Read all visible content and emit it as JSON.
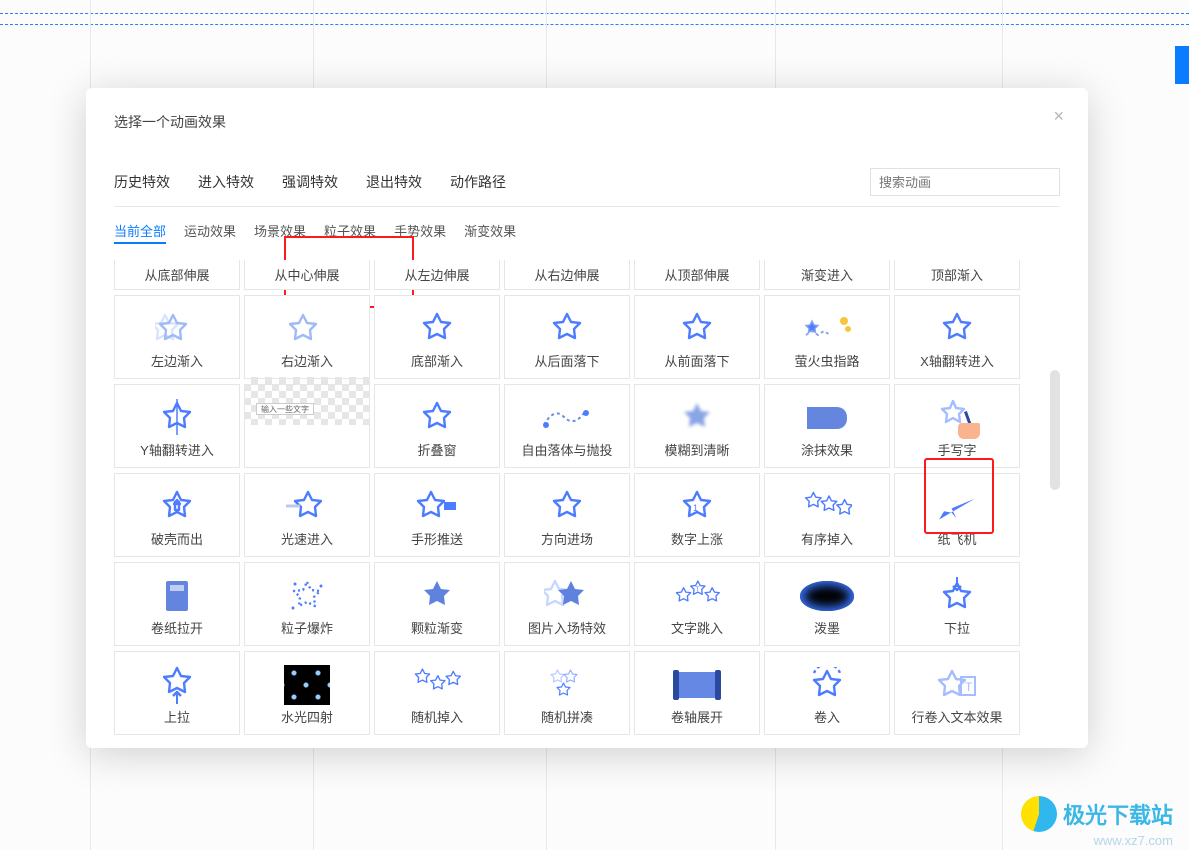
{
  "modal_title": "选择一个动画效果",
  "search_placeholder": "搜索动画",
  "tabs_main": [
    "历史特效",
    "进入特效",
    "强调特效",
    "退出特效",
    "动作路径"
  ],
  "tabs_sub": [
    "当前全部",
    "运动效果",
    "场景效果",
    "粒子效果",
    "手势效果",
    "渐变效果"
  ],
  "tab_main_selected": 1,
  "tab_sub_selected": 0,
  "checker_label": "输入一些文字",
  "effects": [
    [
      "从底部伸展",
      "从中心伸展",
      "从左边伸展",
      "从右边伸展",
      "从顶部伸展",
      "渐变进入",
      "顶部渐入"
    ],
    [
      "左边渐入",
      "右边渐入",
      "底部渐入",
      "从后面落下",
      "从前面落下",
      "萤火虫指路",
      "X轴翻转进入"
    ],
    [
      "Y轴翻转进入",
      "",
      "折叠窗",
      "自由落体与抛投",
      "模糊到清晰",
      "涂抹效果",
      "手写字"
    ],
    [
      "破壳而出",
      "光速进入",
      "手形推送",
      "方向进场",
      "数字上涨",
      "有序掉入",
      "纸飞机"
    ],
    [
      "卷纸拉开",
      "粒子爆炸",
      "颗粒渐变",
      "图片入场特效",
      "文字跳入",
      "泼墨",
      "下拉"
    ],
    [
      "上拉",
      "水光四射",
      "随机掉入",
      "随机拼凑",
      "卷轴展开",
      "卷入",
      "行卷入文本效果"
    ]
  ],
  "watermark": {
    "title": "极光下载站",
    "url": "www.xz7.com"
  }
}
